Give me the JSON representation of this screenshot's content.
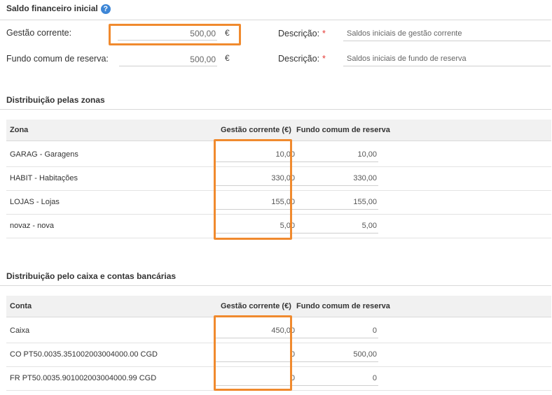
{
  "saldo": {
    "title": "Saldo financeiro inicial",
    "help_symbol": "?",
    "gestao_label": "Gestão corrente:",
    "gestao_value": "500,00",
    "fundo_label": "Fundo comum de reserva:",
    "fundo_value": "500,00",
    "currency": "€",
    "desc_label": "Descrição:",
    "required_mark": "*",
    "gestao_desc": "Saldos iniciais de gestão corrente",
    "fundo_desc": "Saldos iniciais de fundo de reserva"
  },
  "zonas": {
    "title": "Distribuição pelas zonas",
    "col_name": "Zona",
    "col_gestao": "Gestão corrente (€)",
    "col_fundo": "Fundo comum de reserva",
    "rows": [
      {
        "name": "GARAG - Garagens",
        "gestao": "10,00",
        "fundo": "10,00"
      },
      {
        "name": "HABIT - Habitações",
        "gestao": "330,00",
        "fundo": "330,00"
      },
      {
        "name": "LOJAS - Lojas",
        "gestao": "155,00",
        "fundo": "155,00"
      },
      {
        "name": "novaz - nova",
        "gestao": "5,00",
        "fundo": "5,00"
      }
    ]
  },
  "contas": {
    "title": "Distribuição pelo caixa e contas bancárias",
    "col_name": "Conta",
    "col_gestao": "Gestão corrente (€)",
    "col_fundo": "Fundo comum de reserva",
    "rows": [
      {
        "name": "Caixa",
        "gestao": "450,00",
        "fundo": "0"
      },
      {
        "name": "CO PT50.0035.351002003004000.00 CGD",
        "gestao": "0",
        "fundo": "500,00"
      },
      {
        "name": "FR PT50.0035.901002003004000.99 CGD",
        "gestao": "0",
        "fundo": "0"
      }
    ]
  },
  "colors": {
    "highlight": "#f08a2e",
    "help_icon": "#3d86d6",
    "required": "#e53935",
    "header_bg": "#f1f1f1"
  }
}
